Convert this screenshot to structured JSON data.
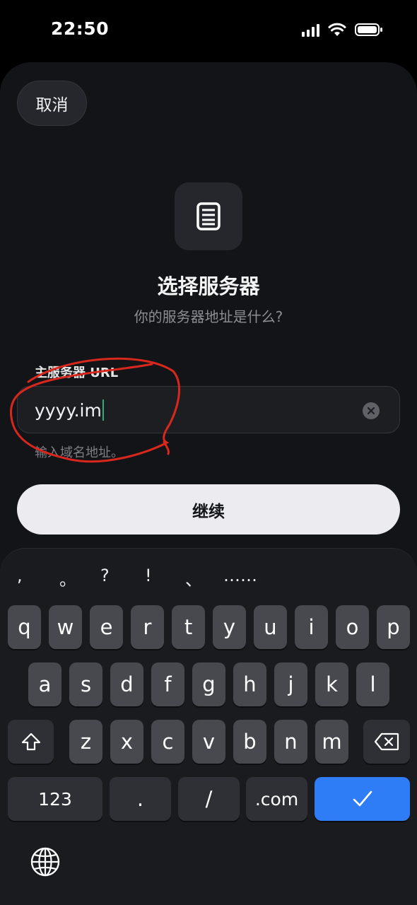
{
  "status": {
    "time": "22:50"
  },
  "header": {
    "cancel_label": "取消"
  },
  "main": {
    "title": "选择服务器",
    "subtitle": "你的服务器地址是什么?",
    "field_label": "主服务器 URL",
    "url_value": "yyyy.im",
    "helper_text": "输入域名地址。",
    "continue_label": "继续"
  },
  "keyboard": {
    "punctuation": [
      ",",
      "。",
      "?",
      "!",
      "、",
      "……"
    ],
    "row1": [
      "q",
      "w",
      "e",
      "r",
      "t",
      "y",
      "u",
      "i",
      "o",
      "p"
    ],
    "row2": [
      "a",
      "s",
      "d",
      "f",
      "g",
      "h",
      "j",
      "k",
      "l"
    ],
    "row3": [
      "z",
      "x",
      "c",
      "v",
      "b",
      "n",
      "m"
    ],
    "numbers_label": "123",
    "dot_label": ".",
    "slash_label": "/",
    "dotcom_label": ".com"
  },
  "colors": {
    "accent": "#2f7df6",
    "annotation": "#d8281d",
    "caret": "#2fae7a"
  }
}
